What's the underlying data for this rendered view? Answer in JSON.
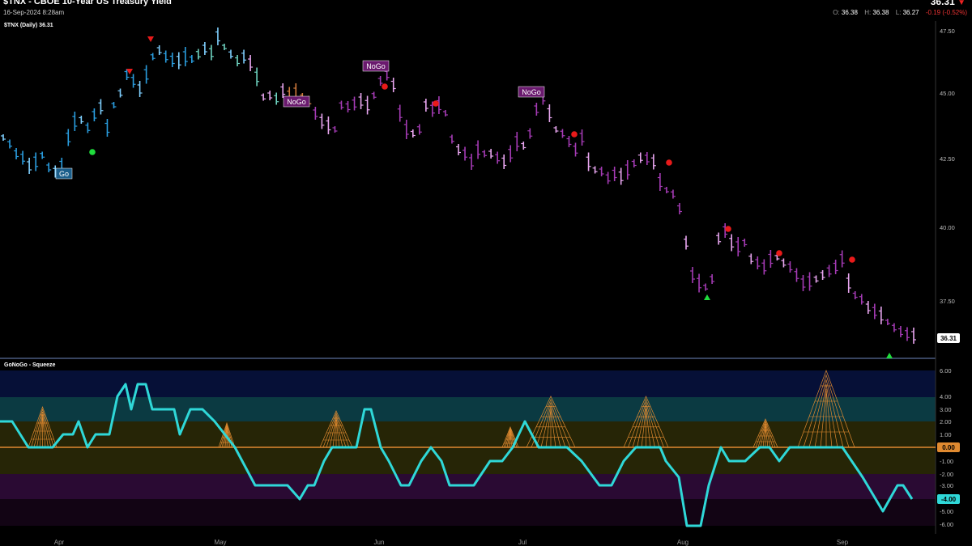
{
  "header": {
    "title": "$TNX - CBOE 10-Year US Treasury Yield",
    "datetime": "16-Sep-2024 8:28am",
    "last_price": "36.31",
    "ohlc": {
      "o_label": "O:",
      "o": "36.38",
      "h_label": "H:",
      "h": "36.38",
      "l_label": "L:",
      "l": "36.27",
      "change": "-0.19 (-0.52%)"
    }
  },
  "price_panel": {
    "label": "$TNX (Daily) 36.31",
    "y_ticks": [
      "47.50",
      "45.00",
      "42.50",
      "40.00",
      "37.50"
    ],
    "last_label": "36.31",
    "badges": [
      "Go",
      "NoGo",
      "NoGo",
      "NoGo"
    ]
  },
  "oscillator_panel": {
    "label": "GoNoGo - Squeeze",
    "y_ticks": [
      "6.00",
      "4.00",
      "3.00",
      "2.00",
      "1.00",
      "-1.00",
      "-2.00",
      "-3.00",
      "-5.00",
      "-6.00"
    ],
    "zero_label": "0.00",
    "last_label": "-4.00"
  },
  "x_axis": {
    "months": [
      "Apr",
      "May",
      "Jun",
      "Jul",
      "Aug",
      "Sep"
    ]
  },
  "colors": {
    "go_blue": "#2a9ee0",
    "go_light": "#7fd0ff",
    "nogo_purple": "#a53bb5",
    "nogo_pink": "#e9a6f0",
    "neutral": "#d07a3c",
    "oscillator": "#2fd8d8",
    "bg": "#000000"
  }
}
